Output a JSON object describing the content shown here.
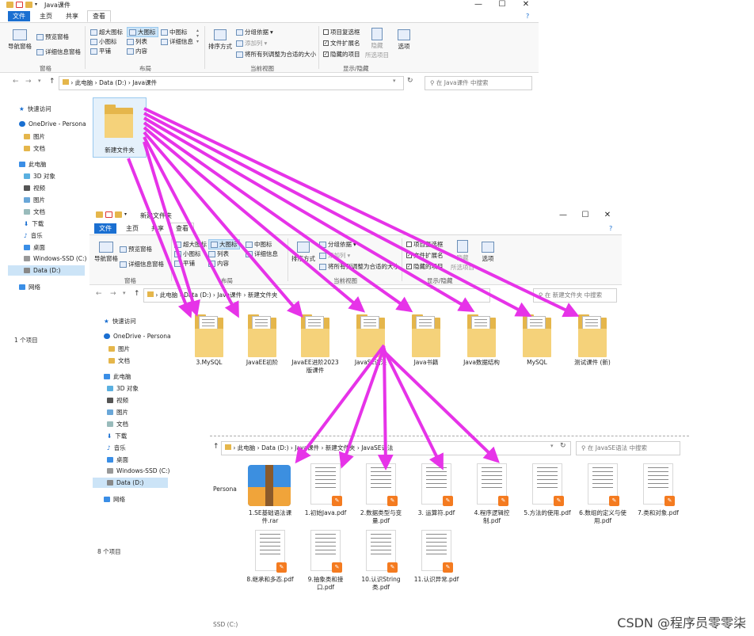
{
  "win1": {
    "title": "Java课件",
    "tabs": [
      "文件",
      "主页",
      "共享",
      "查看"
    ],
    "ribbon": {
      "nav_pane": "导航窗格",
      "preview_pane": "预览窗格",
      "details_pane": "详细信息窗格",
      "group_pane": "窗格",
      "extra_large": "超大图标",
      "large": "大图标",
      "medium": "中图标",
      "small": "小图标",
      "list": "列表",
      "details": "详细信息",
      "tiles": "平铺",
      "content": "内容",
      "group_layout": "布局",
      "sort_by": "排序方式",
      "group_by": "分组依据",
      "add_column": "添加列",
      "fit_columns": "将所有列调整为合适的大小",
      "group_current": "当前视图",
      "item_checkboxes": "项目复选框",
      "file_ext": "文件扩展名",
      "hidden_items": "隐藏的项目",
      "hide_selected": "隐藏",
      "hide_selected2": "所选项目",
      "group_showhide": "显示/隐藏",
      "options": "选项"
    },
    "breadcrumb": [
      "此电脑",
      "Data (D:)",
      "Java课件"
    ],
    "search_placeholder": "在 Java课件 中搜索",
    "nav": [
      "快速访问",
      "OneDrive - Persona",
      "图片",
      "文档",
      "此电脑",
      "3D 对象",
      "视频",
      "图片",
      "文档",
      "下载",
      "音乐",
      "桌面",
      "Windows-SSD (C:)",
      "Data (D:)",
      "网络"
    ],
    "folder_label": "新建文件夹",
    "status": "1 个项目"
  },
  "win2": {
    "title": "新建文件夹",
    "tabs": [
      "文件",
      "主页",
      "共享",
      "查看"
    ],
    "ribbon": {
      "nav_pane": "导航窗格",
      "preview_pane": "预览窗格",
      "details_pane": "详细信息窗格",
      "group_pane": "窗格",
      "extra_large": "超大图标",
      "large": "大图标",
      "medium": "中图标",
      "small": "小图标",
      "list": "列表",
      "details": "详细信息",
      "tiles": "平铺",
      "content": "内容",
      "group_layout": "布局",
      "sort_by": "排序方式",
      "group_by": "分组依据",
      "add_column": "添加列",
      "fit_columns": "将所有列调整为合适的大小",
      "group_current": "当前视图",
      "item_checkboxes": "项目复选框",
      "file_ext": "文件扩展名",
      "hidden_items": "隐藏的项目",
      "hide_selected": "隐藏",
      "hide_selected2": "所选项目",
      "group_showhide": "显示/隐藏",
      "options": "选项"
    },
    "breadcrumb": [
      "此电脑",
      "Data (D:)",
      "Java课件",
      "新建文件夹"
    ],
    "search_placeholder": "在 新建文件夹 中搜索",
    "nav": [
      "快速访问",
      "OneDrive - Persona",
      "图片",
      "文档",
      "此电脑",
      "3D 对象",
      "视频",
      "图片",
      "文档",
      "下载",
      "音乐",
      "桌面",
      "Windows-SSD (C:)",
      "Data (D:)",
      "网络"
    ],
    "folders": [
      "3.MySQL",
      "JavaEE初阶",
      "JavaEE进阶2023版课件",
      "JavaSE语法",
      "Java书籍",
      "Java数据结构",
      "MySQL",
      "测试课件 (新)"
    ],
    "status": "8 个项目"
  },
  "win3": {
    "breadcrumb": [
      "此电脑",
      "Data (D:)",
      "Java课件",
      "新建文件夹",
      "JavaSE语法"
    ],
    "search_placeholder": "在 JavaSE语法 中搜索",
    "nav_partial": "Persona",
    "nav_bottom": "SSD (C:)",
    "files": [
      "1.SE基础语法课件.rar",
      "1.初始Java.pdf",
      "2.数据类型与变量.pdf",
      "3. 运算符.pdf",
      "4.程序逻辑控制.pdf",
      "5.方法的使用.pdf",
      "6.数组的定义与使用.pdf",
      "7.类和对象.pdf",
      "8.继承和多态.pdf",
      "9.抽象类和接口.pdf",
      "10.认识String类.pdf",
      "11.认识异常.pdf"
    ]
  },
  "watermark": "CSDN @程序员零零柒",
  "colors": {
    "accent": "#1a6fd1",
    "arrow": "#e633e8",
    "folder": "#f5d27a",
    "pdf_badge": "#f47b20"
  }
}
